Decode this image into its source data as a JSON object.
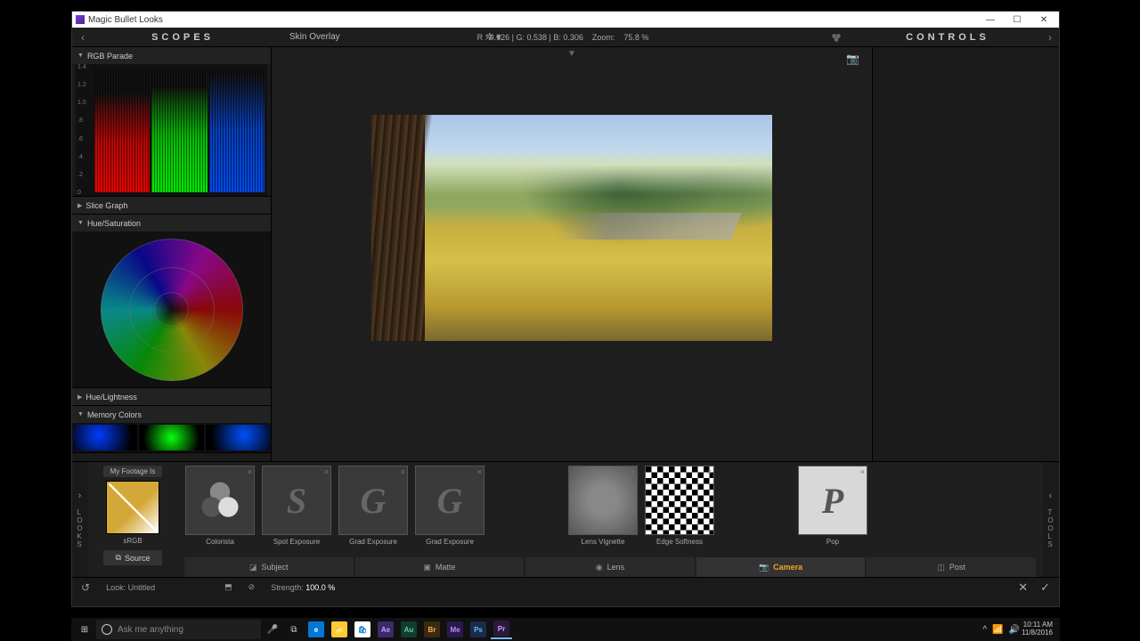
{
  "titlebar": {
    "title": "Magic Bullet Looks",
    "min": "—",
    "max": "☐",
    "close": "✕"
  },
  "topbar": {
    "back": "‹",
    "scopes": "SCOPES",
    "preview_label": "Skin Overlay",
    "rgb": "R : 0.626 | G: 0.538 | B: 0.306",
    "zoom_label": "Zoom:",
    "zoom_value": "75.8 %",
    "controls": "CONTROLS",
    "fwd": "›"
  },
  "scopes": {
    "rgb_parade": "RGB Parade",
    "parade_ticks": [
      "1.4",
      "1.2",
      "1.0",
      ".8",
      ".6",
      ".4",
      ".2",
      "0"
    ],
    "slice_graph": "Slice Graph",
    "hue_sat": "Hue/Saturation",
    "hue_light": "Hue/Lightness",
    "memory_colors": "Memory Colors"
  },
  "chain": {
    "expand_left": "›",
    "expand_right": "‹",
    "looks": "LOOKS",
    "tools": "TOOLS",
    "my_footage": "My Footage Is",
    "srgb": "sRGB",
    "source": "Source",
    "items": [
      {
        "label": "Colorista",
        "type": "colorista"
      },
      {
        "label": "Spot Exposure",
        "type": "letter",
        "letter": "S"
      },
      {
        "label": "Grad Exposure",
        "type": "letter",
        "letter": "G"
      },
      {
        "label": "Grad Exposure",
        "type": "letter",
        "letter": "G"
      }
    ],
    "items2": [
      {
        "label": "Lens Vignette",
        "type": "vignette"
      },
      {
        "label": "Edge Softness",
        "type": "checker"
      }
    ],
    "items3": [
      {
        "label": "Pop",
        "type": "pop",
        "letter": "P"
      }
    ],
    "tabs": [
      {
        "label": "Subject",
        "icon": "◪"
      },
      {
        "label": "Matte",
        "icon": "▣"
      },
      {
        "label": "Lens",
        "icon": "◉"
      },
      {
        "label": "Camera",
        "icon": "📷",
        "active": true
      },
      {
        "label": "Post",
        "icon": "◫"
      }
    ]
  },
  "bottombar": {
    "undo": "↺",
    "look_label": "Look:",
    "look_name": "Untitled",
    "save": "⬒",
    "strength_icon": "⊘",
    "strength_label": "Strength:",
    "strength_value": "100.0 %",
    "cancel": "✕",
    "apply": "✓"
  },
  "taskbar": {
    "start": "⊞",
    "search_placeholder": "Ask me anything",
    "mic": "🎤",
    "taskview": "⧉",
    "apps": [
      {
        "bg": "#0078d7",
        "fg": "#fff",
        "txt": "e"
      },
      {
        "bg": "#ffcc33",
        "fg": "#7a5",
        "txt": "📁"
      },
      {
        "bg": "#fff",
        "fg": "#0078d7",
        "txt": "🛍"
      },
      {
        "bg": "#3b2a6b",
        "fg": "#c9f",
        "txt": "Ae"
      },
      {
        "bg": "#113c2e",
        "fg": "#6c9",
        "txt": "Au"
      },
      {
        "bg": "#3a2a10",
        "fg": "#fa5",
        "txt": "Br"
      },
      {
        "bg": "#2a1a4a",
        "fg": "#b8f",
        "txt": "Me"
      },
      {
        "bg": "#1a2a4a",
        "fg": "#6bf",
        "txt": "Ps"
      },
      {
        "bg": "#2a1a3a",
        "fg": "#d9f",
        "txt": "Pr",
        "active": true
      }
    ],
    "tray": {
      "up": "^",
      "net": "📶",
      "vol": "🔊"
    },
    "time": "10:11 AM",
    "date": "11/8/2016"
  }
}
